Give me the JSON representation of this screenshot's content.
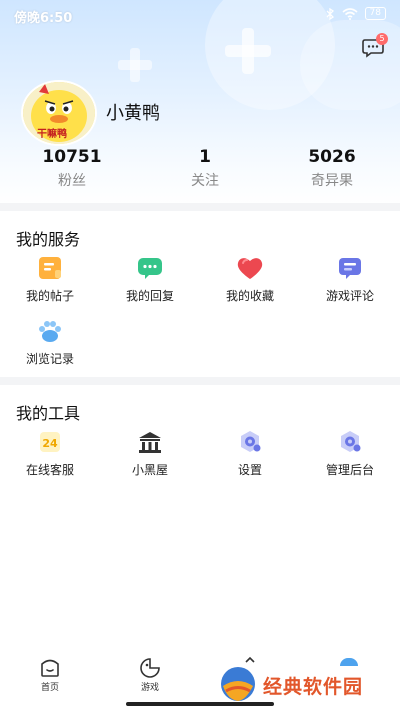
{
  "status_bar": {
    "time": "傍晚6:50",
    "battery": "78"
  },
  "header": {
    "message_badge": "5",
    "avatar_text": "干嘛鸭",
    "username": "小黄鸭"
  },
  "stats": [
    {
      "value": "10751",
      "label": "粉丝"
    },
    {
      "value": "1",
      "label": "关注"
    },
    {
      "value": "5026",
      "label": "奇异果"
    }
  ],
  "services": {
    "title": "我的服务",
    "items": [
      {
        "label": "我的帖子",
        "icon": "post-icon"
      },
      {
        "label": "我的回复",
        "icon": "reply-icon"
      },
      {
        "label": "我的收藏",
        "icon": "heart-icon"
      },
      {
        "label": "游戏评论",
        "icon": "game-comment-icon"
      },
      {
        "label": "浏览记录",
        "icon": "paw-icon"
      }
    ]
  },
  "tools": {
    "title": "我的工具",
    "items": [
      {
        "label": "在线客服",
        "icon": "support-24-icon",
        "badge": "24"
      },
      {
        "label": "小黑屋",
        "icon": "blackhouse-icon"
      },
      {
        "label": "设置",
        "icon": "settings-icon"
      },
      {
        "label": "管理后台",
        "icon": "admin-icon"
      }
    ]
  },
  "tabbar": {
    "tabs": [
      {
        "label": "首页",
        "icon": "home-icon"
      },
      {
        "label": "游戏",
        "icon": "game-icon"
      }
    ]
  },
  "watermark": {
    "text": "经典软件园"
  },
  "colors": {
    "accent_orange": "#ffb13d",
    "accent_green": "#35c58a",
    "accent_red": "#ec4850",
    "accent_indigo": "#6a76e6",
    "accent_blue": "#5aaaf0",
    "header_blue": "#cfe6ff"
  }
}
